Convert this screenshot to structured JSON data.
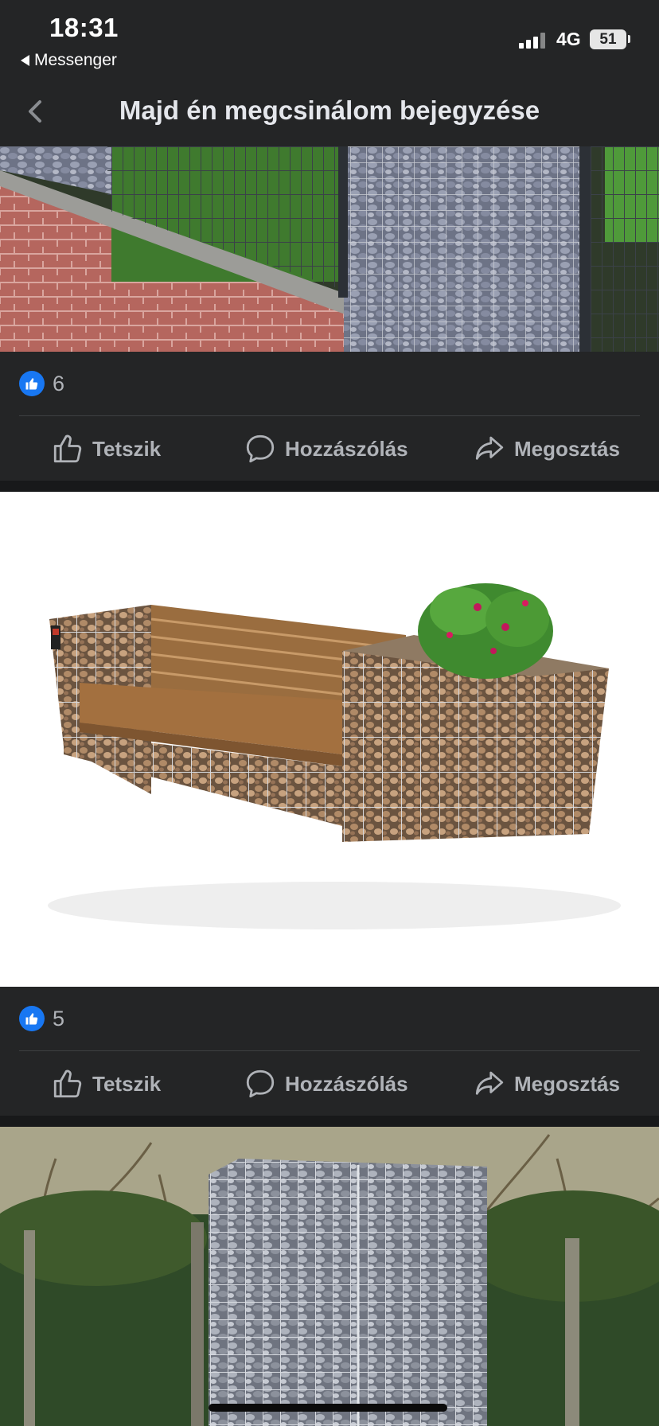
{
  "status_bar": {
    "time": "18:31",
    "back_app": "Messenger",
    "network": "4G",
    "battery": "51"
  },
  "header": {
    "title": "Majd én megcsinálom bejegyzése",
    "back_icon": "chevron-left-icon"
  },
  "posts": [
    {
      "reaction_count": "6",
      "actions": {
        "like": "Tetszik",
        "comment": "Hozzászólás",
        "share": "Megosztás"
      }
    },
    {
      "reaction_count": "5",
      "actions": {
        "like": "Tetszik",
        "comment": "Hozzászólás",
        "share": "Megosztás"
      }
    }
  ],
  "colors": {
    "background": "#18191a",
    "bar": "#242526",
    "text": "#e4e6eb",
    "muted": "#b0b3b8",
    "accent": "#1877f2"
  }
}
